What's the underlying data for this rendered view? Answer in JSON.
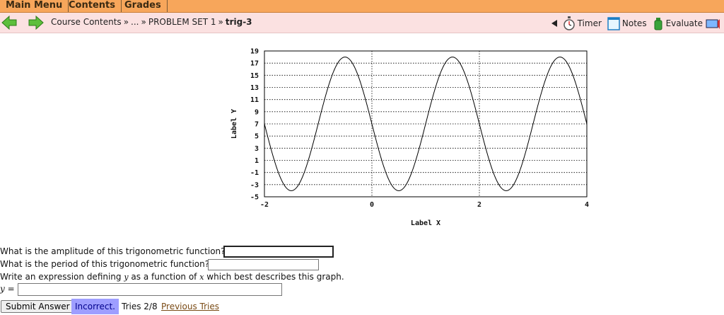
{
  "menu": {
    "items": [
      "Main Menu",
      "Contents",
      "Grades"
    ]
  },
  "nav": {
    "back_icon": "left-arrow-icon",
    "forward_icon": "right-arrow-icon",
    "breadcrumb": [
      "Course Contents",
      "...",
      "PROBLEM SET 1",
      "trig-3"
    ],
    "separator": "»",
    "tools": {
      "timer": "Timer",
      "notes": "Notes",
      "evaluate": "Evaluate"
    }
  },
  "chart_data": {
    "type": "line",
    "xlabel": "Label X",
    "ylabel": "Label Y",
    "xlim": [
      -2,
      4
    ],
    "ylim": [
      -5,
      19
    ],
    "xticks": [
      -2,
      0,
      2,
      4
    ],
    "yticks": [
      19,
      17,
      15,
      13,
      11,
      9,
      7,
      5,
      3,
      1,
      -1,
      -3,
      -5
    ],
    "grid": true,
    "series": [
      {
        "function": "7 - 11*sin(pi*x)",
        "amplitude": 11,
        "period": 2,
        "midline": 7
      }
    ]
  },
  "questions": {
    "q1": "What is the amplitude of this trigonometric function?",
    "q2": "What is the period of this trigonometric function?",
    "q3_part1": "Write an expression defining",
    "q3_var_y": "y",
    "q3_part2": "as a function of",
    "q3_var_x": "x",
    "q3_part3": "which best describes this graph.",
    "y_label": "y =",
    "answers": {
      "amplitude": "",
      "period": "",
      "expression": ""
    }
  },
  "submit": {
    "button": "Submit Answer",
    "status": "Incorrect.",
    "tries": "Tries 2/8",
    "previous": "Previous Tries"
  }
}
